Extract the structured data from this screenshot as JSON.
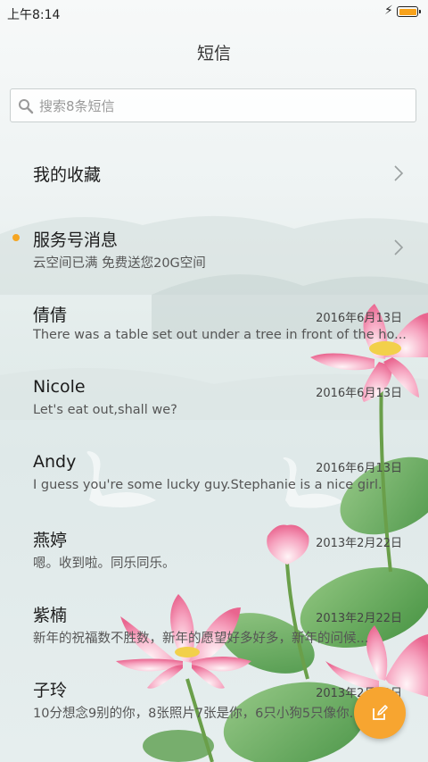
{
  "status_bar": {
    "time": "上午8:14"
  },
  "header": {
    "title": "短信"
  },
  "search": {
    "placeholder": "搜索8条短信"
  },
  "favorites": {
    "label": "我的收藏"
  },
  "service": {
    "title": "服务号消息",
    "preview": "云空间已满 免费送您20G空间"
  },
  "conversations": [
    {
      "name": "倩倩",
      "date": "2016年6月13日",
      "preview": "There was a table set out under a tree in front of the ho..."
    },
    {
      "name": "Nicole",
      "date": "2016年6月13日",
      "preview": "Let's eat out,shall we?"
    },
    {
      "name": "Andy",
      "date": "2016年6月13日",
      "preview": "I guess you're some lucky guy.Stephanie is a nice girl."
    },
    {
      "name": "燕婷",
      "date": "2013年2月22日",
      "preview": "嗯。收到啦。同乐同乐。"
    },
    {
      "name": "紫楠",
      "date": "2013年2月22日",
      "preview": "新年的祝福数不胜数，新年的愿望好多好多，新年的问候..."
    },
    {
      "name": "子玲",
      "date": "2013年2月22日",
      "preview": "10分想念9别的你，8张照片7张是你，6只小狗5只像你..."
    }
  ],
  "colors": {
    "accent": "#f7a530",
    "unread_dot": "#f5a623"
  },
  "icons": {
    "search": "search-icon",
    "chevron": "chevron-right-icon",
    "compose": "compose-icon",
    "charging": "charging-icon",
    "battery": "battery-icon"
  }
}
